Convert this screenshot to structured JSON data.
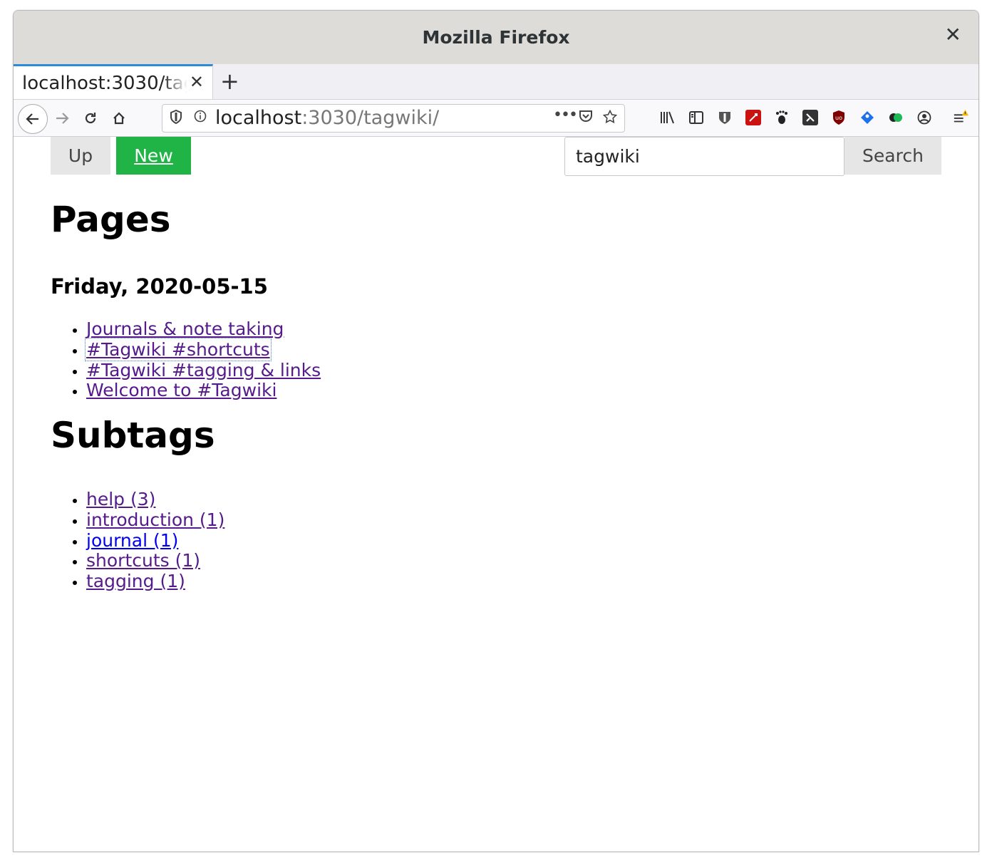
{
  "window": {
    "title": "Mozilla Firefox"
  },
  "tab": {
    "title": "localhost:3030/tagwiki/"
  },
  "urlbar": {
    "host": "localhost",
    "rest": ":3030/tagwiki/"
  },
  "toolbar": {
    "up_label": "Up",
    "new_label": "New",
    "search_value": "tagwiki",
    "search_label": "Search"
  },
  "main": {
    "pages_heading": "Pages",
    "date_heading": "Friday, 2020-05-15",
    "pages": [
      "Journals & note taking",
      "#Tagwiki #shortcuts",
      "#Tagwiki #tagging & links",
      "Welcome to #Tagwiki"
    ],
    "subtags_heading": "Subtags",
    "subtags": [
      "help (3)",
      "introduction (1)",
      "journal (1)",
      "shortcuts (1)",
      "tagging (1)"
    ]
  },
  "colors": {
    "new_button": "#1fb445",
    "visited_link": "#551a8b",
    "unvisited_link": "#0000ee",
    "tab_accent": "#2c8bd9"
  },
  "icons": [
    "close-icon",
    "new-tab-icon",
    "back-icon",
    "forward-icon",
    "reload-icon",
    "home-icon",
    "shield-icon",
    "info-icon",
    "more-icon",
    "pocket-icon",
    "bookmark-star-icon",
    "library-icon",
    "sidebar-icon",
    "bitwarden-icon",
    "ext-red-icon",
    "gnome-icon",
    "ext-dark-icon",
    "ublock-icon",
    "ext-blue-icon",
    "ext-green-icon",
    "account-icon",
    "menu-icon"
  ]
}
